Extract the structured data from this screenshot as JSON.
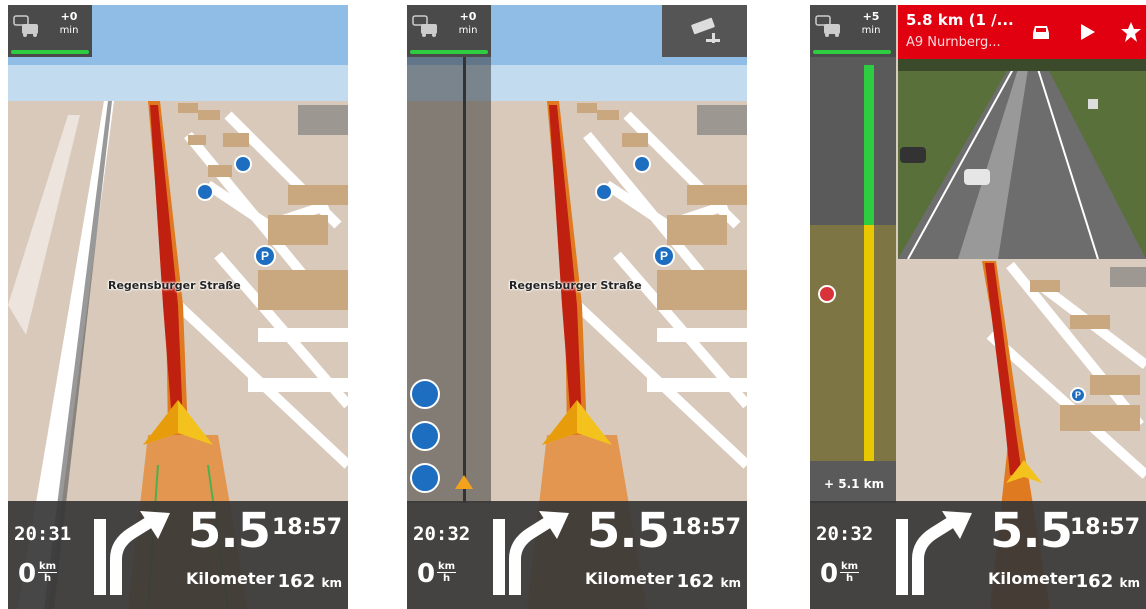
{
  "screens": [
    {
      "traffic_delay": "+0",
      "traffic_delay_unit": "min",
      "street_name": "Regensburger Straße",
      "clock": "20:31",
      "speed_value": "0",
      "speed_unit_top": "km",
      "speed_unit_bottom": "h",
      "distance_value": "5.5",
      "distance_unit": "Kilometer",
      "eta": "18:57",
      "remaining_value": "162",
      "remaining_unit": "km"
    },
    {
      "traffic_delay": "+0",
      "traffic_delay_unit": "min",
      "street_name": "Regensburger Straße",
      "clock": "20:32",
      "speed_value": "0",
      "speed_unit_top": "km",
      "speed_unit_bottom": "h",
      "distance_value": "5.5",
      "distance_unit": "Kilometer",
      "eta": "18:57",
      "remaining_value": "162",
      "remaining_unit": "km"
    },
    {
      "traffic_delay": "+5",
      "traffic_delay_unit": "min",
      "header_title": "5.8 km (1 /...",
      "header_subtitle": "A9 Nurnberg...",
      "jam_length": "+ 5.1 km",
      "clock": "20:32",
      "speed_value": "0",
      "speed_unit_top": "km",
      "speed_unit_bottom": "h",
      "distance_value": "5.5",
      "distance_unit": "Kilometer",
      "eta": "18:57",
      "remaining_value": "162",
      "remaining_unit": "km"
    }
  ],
  "icons": {
    "traffic": "traffic-jam-icon",
    "speed_camera": "speed-camera-icon",
    "fuel": "fuel-station-icon",
    "parking": "parking-icon",
    "car": "car-icon",
    "play": "play-icon",
    "star": "star-icon",
    "turn": "turn-right-arrow-icon"
  },
  "colors": {
    "route": "#c0200f",
    "route_border": "#e07a20",
    "traffic_ok": "#2ecc40",
    "traffic_slow": "#e8c800",
    "header_red": "#e1000f",
    "poi_blue": "#1d6ec0"
  }
}
